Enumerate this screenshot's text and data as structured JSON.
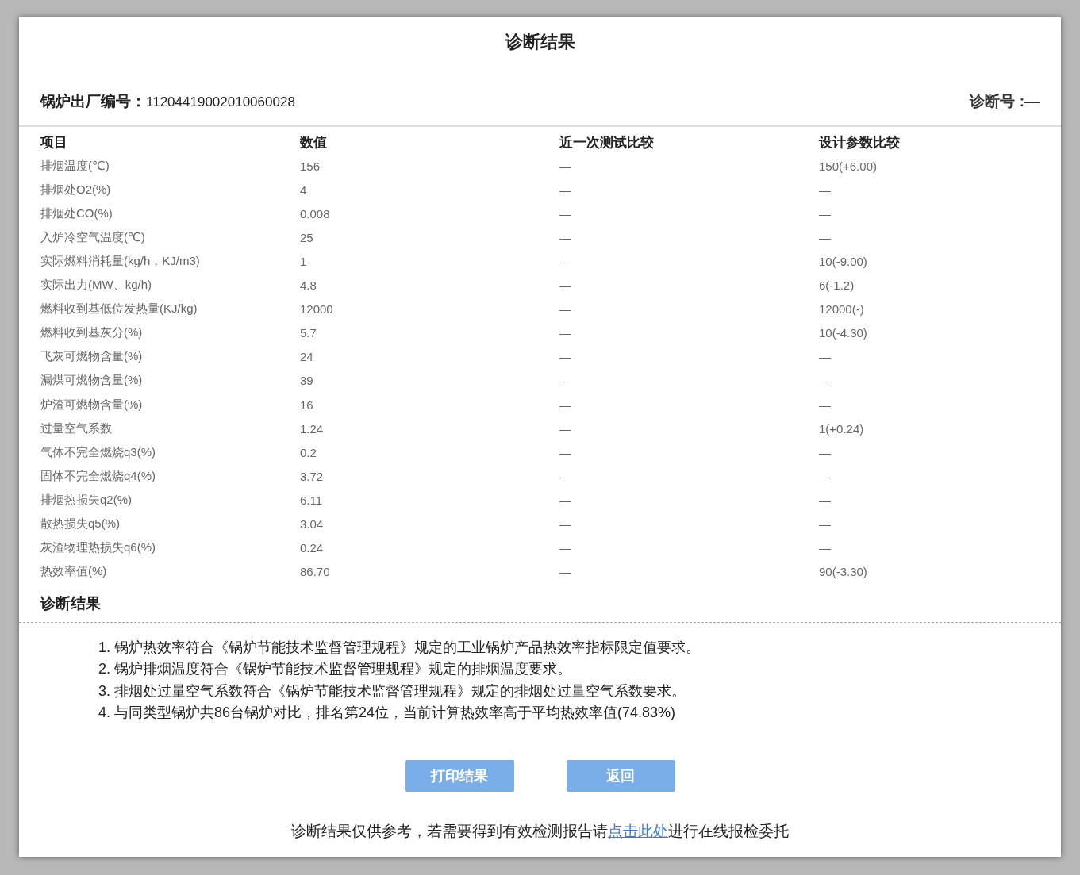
{
  "title": "诊断结果",
  "header": {
    "serial_label": "锅炉出厂编号：",
    "serial_value": "11204419002010060028",
    "diag_label": "诊断号 :—"
  },
  "table": {
    "columns": [
      "项目",
      "数值",
      "近一次测试比较",
      "设计参数比较"
    ],
    "rows": [
      [
        "排烟温度(℃)",
        "156",
        "—",
        "150(+6.00)"
      ],
      [
        "排烟处O2(%)",
        "4",
        "—",
        "—"
      ],
      [
        "排烟处CO(%)",
        "0.008",
        "—",
        "—"
      ],
      [
        "入炉冷空气温度(℃)",
        "25",
        "—",
        "—"
      ],
      [
        "实际燃料消耗量(kg/h，KJ/m3)",
        "1",
        "—",
        "10(-9.00)"
      ],
      [
        "实际出力(MW、kg/h)",
        "4.8",
        "—",
        "6(-1.2)"
      ],
      [
        "燃料收到基低位发热量(KJ/kg)",
        "12000",
        "—",
        "12000(-)"
      ],
      [
        "燃料收到基灰分(%)",
        "5.7",
        "—",
        "10(-4.30)"
      ],
      [
        "飞灰可燃物含量(%)",
        "24",
        "—",
        "—"
      ],
      [
        "漏煤可燃物含量(%)",
        "39",
        "—",
        "—"
      ],
      [
        "炉渣可燃物含量(%)",
        "16",
        "—",
        "—"
      ],
      [
        "过量空气系数",
        "1.24",
        "—",
        "1(+0.24)"
      ],
      [
        "气体不完全燃烧q3(%)",
        "0.2",
        "—",
        "—"
      ],
      [
        "固体不完全燃烧q4(%)",
        "3.72",
        "—",
        "—"
      ],
      [
        "排烟热损失q2(%)",
        "6.11",
        "—",
        "—"
      ],
      [
        "散热损失q5(%)",
        "3.04",
        "—",
        "—"
      ],
      [
        "灰渣物理热损失q6(%)",
        "0.24",
        "—",
        "—"
      ],
      [
        "热效率值(%)",
        "86.70",
        "—",
        "90(-3.30)"
      ]
    ]
  },
  "result": {
    "heading": "诊断结果",
    "items": [
      "1. 锅炉热效率符合《锅炉节能技术监督管理规程》规定的工业锅炉产品热效率指标限定值要求。",
      "2. 锅炉排烟温度符合《锅炉节能技术监督管理规程》规定的排烟温度要求。",
      "3. 排烟处过量空气系数符合《锅炉节能技术监督管理规程》规定的排烟处过量空气系数要求。",
      "4. 与同类型锅炉共86台锅炉对比，排名第24位，当前计算热效率高于平均热效率值(74.83%)"
    ]
  },
  "buttons": [
    "打印结果",
    "返回"
  ],
  "footer": {
    "before": "诊断结果仅供参考，若需要得到有效检测报告请",
    "link": "点击此处",
    "after": "进行在线报检委托"
  }
}
